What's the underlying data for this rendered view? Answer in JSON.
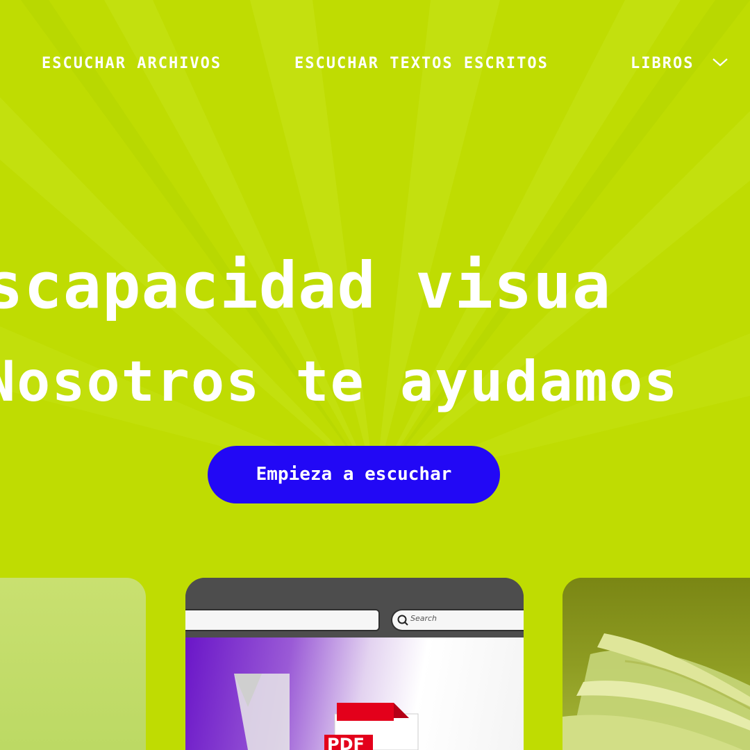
{
  "nav": {
    "items": [
      {
        "label": "ESCUCHAR ARCHIVOS"
      },
      {
        "label": "ESCUCHAR TEXTOS ESCRITOS"
      },
      {
        "label": "LIBROS"
      }
    ],
    "dropdown_icon": "chevron-down-icon"
  },
  "hero": {
    "line1": "scapacidad visua",
    "line2": "Nosotros te ayudamos"
  },
  "cta": {
    "label": "Empieza a escuchar"
  },
  "cards": {
    "pdf_card": {
      "search_placeholder": "Search",
      "badge_text": "PDF",
      "icon": "pdf-file-icon"
    },
    "book_card": {
      "icon": "open-book-image"
    }
  },
  "colors": {
    "background": "#bfdc02",
    "cta_background": "#2208f5",
    "text": "#ffffff"
  }
}
